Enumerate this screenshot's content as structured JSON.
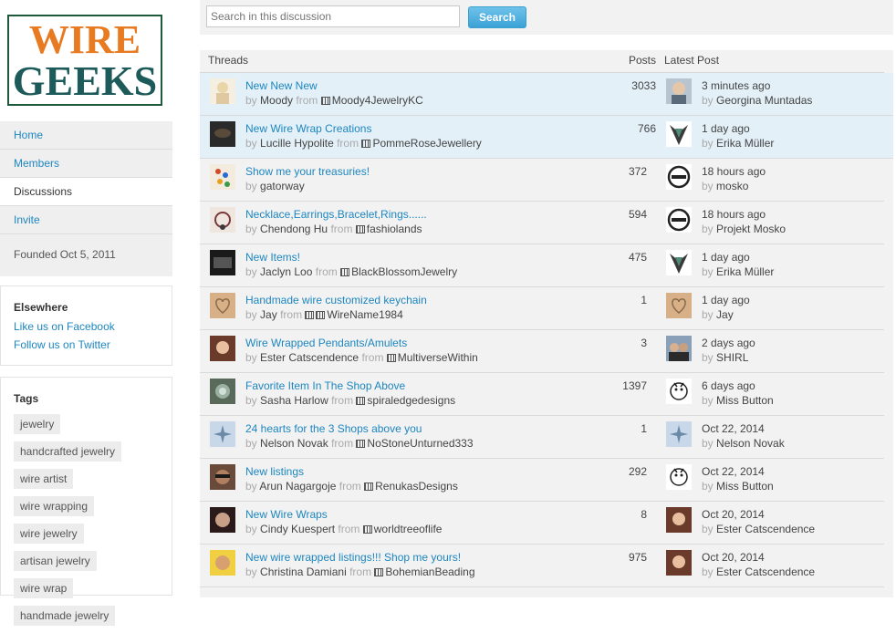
{
  "logo": {
    "line1": "WIRE",
    "line2": "GEEKS",
    "colors": {
      "orange": "#e87a22",
      "teal": "#1d5a5a"
    }
  },
  "nav": {
    "items": [
      {
        "label": "Home"
      },
      {
        "label": "Members"
      },
      {
        "label": "Discussions"
      },
      {
        "label": "Invite"
      }
    ],
    "founded": "Founded Oct 5, 2011"
  },
  "elsewhere": {
    "title": "Elsewhere",
    "links": [
      "Like us on Facebook",
      "Follow us on Twitter"
    ]
  },
  "tags": {
    "title": "Tags",
    "items": [
      "jewelry",
      "handcrafted jewelry",
      "wire artist",
      "wire wrapping",
      "wire jewelry",
      "artisan jewelry",
      "wire wrap",
      "handmade jewelry"
    ]
  },
  "search": {
    "placeholder": "Search in this discussion",
    "button": "Search"
  },
  "table": {
    "headers": {
      "threads": "Threads",
      "posts": "Posts",
      "latest": "Latest Post"
    },
    "rows": [
      {
        "title": "New New New",
        "by": "by",
        "author": "Moody",
        "from": "from",
        "shop": "Moody4JewelryKC",
        "posts": "3033",
        "latest_time": "3 minutes ago",
        "latest_by": "Georgina Muntadas"
      },
      {
        "title": "New Wire Wrap Creations",
        "by": "by",
        "author": "Lucille Hypolite",
        "from": "from",
        "shop": "PommeRoseJewellery",
        "posts": "766",
        "latest_time": "1 day ago",
        "latest_by": "Erika Müller"
      },
      {
        "title": "Show me your treasuries!",
        "by": "by",
        "author": "gatorway",
        "from": "",
        "shop": "",
        "posts": "372",
        "latest_time": "18 hours ago",
        "latest_by": "mosko"
      },
      {
        "title": "Necklace,Earrings,Bracelet,Rings......",
        "by": "by",
        "author": "Chendong Hu",
        "from": "from",
        "shop": "fashiolands",
        "posts": "594",
        "latest_time": "18 hours ago",
        "latest_by": "Projekt Mosko"
      },
      {
        "title": "New Items!",
        "by": "by",
        "author": "Jaclyn Loo",
        "from": "from",
        "shop": "BlackBlossomJewelry",
        "posts": "475",
        "latest_time": "1 day ago",
        "latest_by": "Erika Müller"
      },
      {
        "title": "Handmade wire customized keychain",
        "by": "by",
        "author": "Jay",
        "from": "from",
        "shop": "WireName1984",
        "posts": "1",
        "latest_time": "1 day ago",
        "latest_by": "Jay"
      },
      {
        "title": "Wire Wrapped Pendants/Amulets",
        "by": "by",
        "author": "Ester Catscendence",
        "from": "from",
        "shop": "MultiverseWithin",
        "posts": "3",
        "latest_time": "2 days ago",
        "latest_by": "SHIRL"
      },
      {
        "title": "Favorite Item In The Shop Above",
        "by": "by",
        "author": "Sasha Harlow",
        "from": "from",
        "shop": "spiraledgedesigns",
        "posts": "1397",
        "latest_time": "6 days ago",
        "latest_by": "Miss Button"
      },
      {
        "title": "24 hearts for the 3 Shops above you",
        "by": "by",
        "author": "Nelson Novak",
        "from": "from",
        "shop": "NoStoneUnturned333",
        "posts": "1",
        "latest_time": "Oct 22, 2014",
        "latest_by": "Nelson Novak"
      },
      {
        "title": "New listings",
        "by": "by",
        "author": "Arun Nagargoje",
        "from": "from",
        "shop": "RenukasDesigns",
        "posts": "292",
        "latest_time": "Oct 22, 2014",
        "latest_by": "Miss Button"
      },
      {
        "title": "New Wire Wraps",
        "by": "by",
        "author": "Cindy Kuespert",
        "from": "from",
        "shop": "worldtreeoflife",
        "posts": "8",
        "latest_time": "Oct 20, 2014",
        "latest_by": "Ester Catscendence"
      },
      {
        "title": "New wire wrapped listings!!! Shop me yours!",
        "by": "by",
        "author": "Christina Damiani",
        "from": "from",
        "shop": "BohemianBeading",
        "posts": "975",
        "latest_time": "Oct 20, 2014",
        "latest_by": "Ester Catscendence"
      }
    ]
  }
}
